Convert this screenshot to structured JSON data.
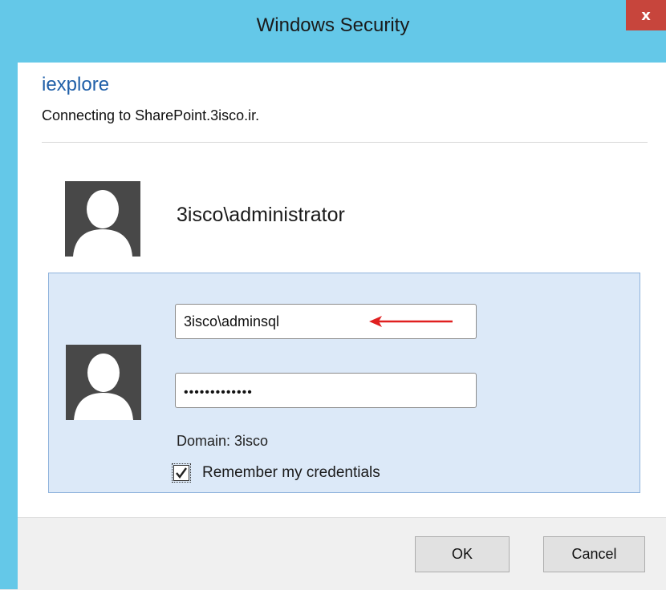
{
  "window": {
    "title": "Windows Security",
    "close_label": "x"
  },
  "header": {
    "app_name": "iexplore",
    "message": "Connecting to SharePoint.3isco.ir."
  },
  "saved_account": {
    "username": "3isco\\administrator",
    "avatar_icon": "user-avatar-icon"
  },
  "credentials": {
    "avatar_icon": "user-avatar-icon",
    "username_value": "3isco\\adminsql",
    "password_value": "•••••••••••••",
    "domain_label": "Domain: 3isco",
    "remember_label": "Remember my credentials",
    "remember_checked": true,
    "annotation_arrow_icon": "red-arrow-icon"
  },
  "footer": {
    "ok_label": "OK",
    "cancel_label": "Cancel"
  },
  "colors": {
    "titlebar": "#64c8e8",
    "close_button": "#c7453c",
    "app_name": "#1f5fa8",
    "panel_background": "#dce9f8",
    "panel_border": "#8fb3dc",
    "annotation_arrow": "#e02020"
  }
}
